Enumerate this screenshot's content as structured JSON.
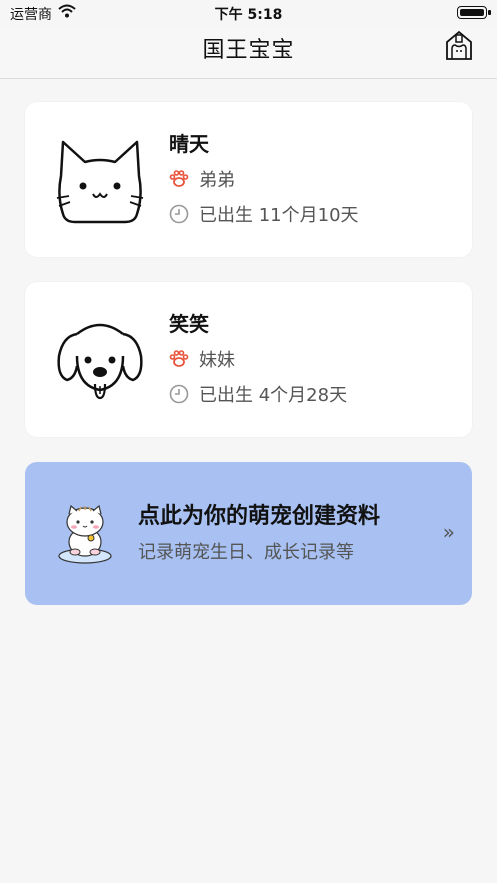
{
  "status": {
    "carrier": "运营商",
    "time": "下午 5:18"
  },
  "nav": {
    "title": "国王宝宝",
    "right_icon": "house-pet-icon"
  },
  "pets": [
    {
      "name": "晴天",
      "gender": "弟弟",
      "age": "已出生 11个月10天",
      "avatar": "cat-icon"
    },
    {
      "name": "笑笑",
      "gender": "妹妹",
      "age": "已出生 4个月28天",
      "avatar": "dog-icon"
    }
  ],
  "create": {
    "title": "点此为你的萌宠创建资料",
    "subtitle": "记录萌宠生日、成长记录等",
    "arrow": "»"
  },
  "colors": {
    "paw": "#e8533b",
    "create_bg": "#a8c1f2"
  }
}
